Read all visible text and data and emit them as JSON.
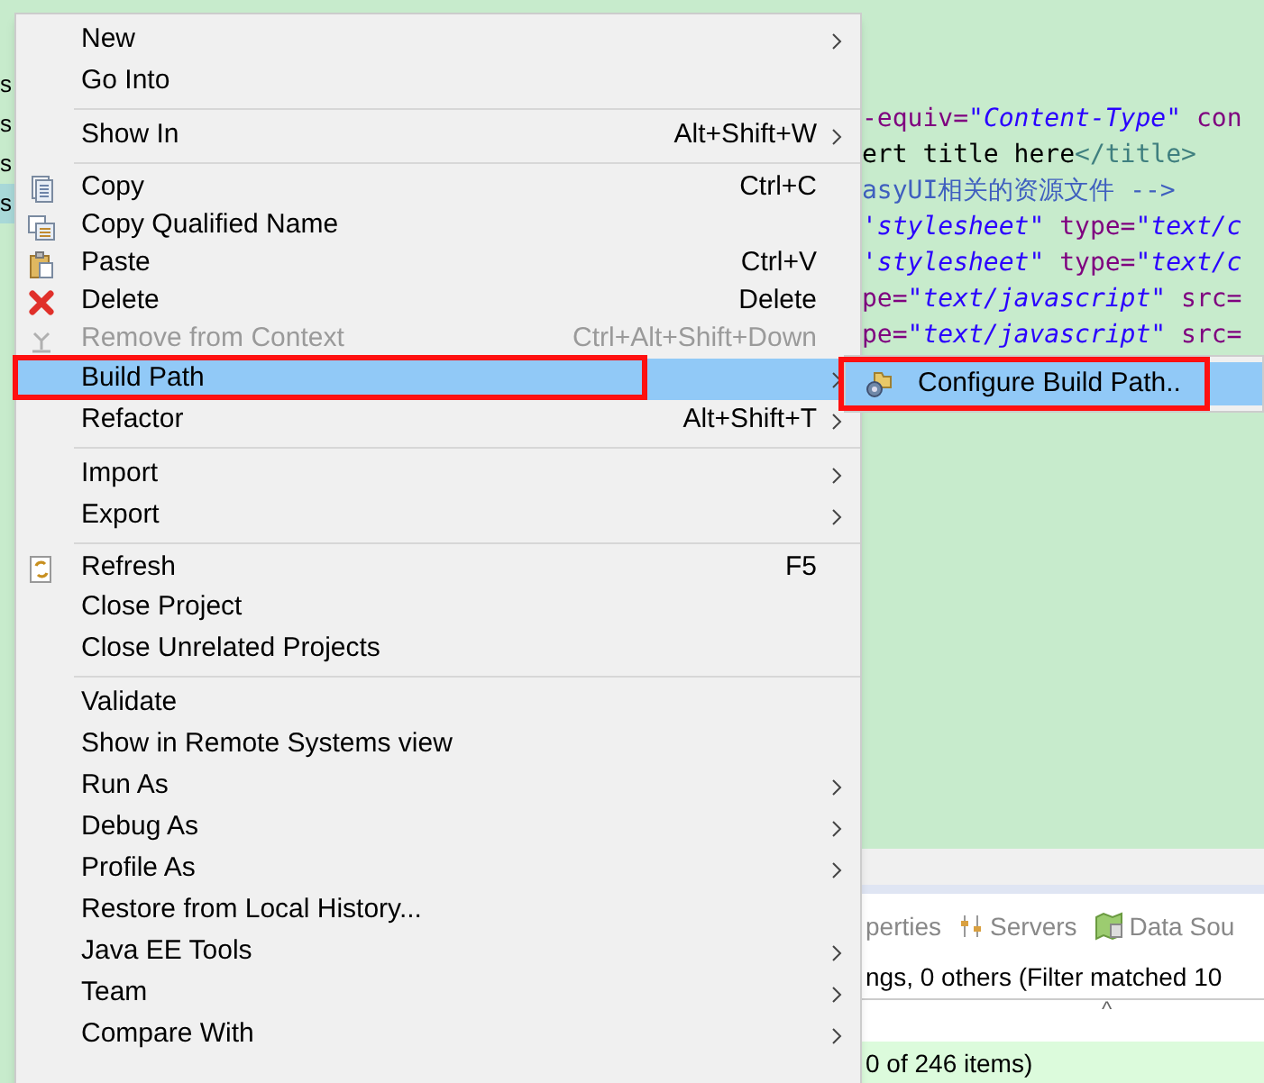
{
  "explorer": {
    "items": [
      {
        "label": "s",
        "selected": false
      },
      {
        "label": "s",
        "selected": false
      },
      {
        "label": "s",
        "selected": false
      },
      {
        "label": "s",
        "selected": true
      }
    ]
  },
  "editor": {
    "lines": [
      {
        "segments": [
          {
            "kind": "attr",
            "text": "-equiv="
          },
          {
            "kind": "string",
            "text": "\"Content-Type\""
          },
          {
            "kind": "attr",
            "text": " con"
          }
        ]
      },
      {
        "segments": [
          {
            "kind": "plain",
            "text": "ert title here"
          },
          {
            "kind": "tag",
            "text": "</title>"
          }
        ]
      },
      {
        "segments": [
          {
            "kind": "comment",
            "text": "asyUI相关的资源文件 -->"
          }
        ]
      },
      {
        "segments": [
          {
            "kind": "string",
            "text": "'stylesheet\""
          },
          {
            "kind": "attr",
            "text": " type="
          },
          {
            "kind": "string",
            "text": "\"text/c"
          }
        ]
      },
      {
        "segments": [
          {
            "kind": "string",
            "text": "'stylesheet\""
          },
          {
            "kind": "attr",
            "text": " type="
          },
          {
            "kind": "string",
            "text": "\"text/c"
          }
        ]
      },
      {
        "segments": [
          {
            "kind": "attr",
            "text": "pe="
          },
          {
            "kind": "string",
            "text": "\"text/javascript\""
          },
          {
            "kind": "attr",
            "text": " src="
          }
        ]
      },
      {
        "segments": [
          {
            "kind": "attr",
            "text": "pe="
          },
          {
            "kind": "string",
            "text": "\"text/javascript\""
          },
          {
            "kind": "attr",
            "text": " src="
          }
        ]
      }
    ]
  },
  "bottom_panel": {
    "tabs": [
      {
        "label": "perties",
        "kind": "none"
      },
      {
        "label": "Servers",
        "kind": "servers"
      },
      {
        "label": "Data Sou",
        "kind": "data"
      }
    ],
    "summary": "ngs, 0 others (Filter matched 10",
    "sort_caret": "^",
    "footer": "0 of 246 items)"
  },
  "context_menu": {
    "sections": [
      [
        {
          "label": "New",
          "submenu": true,
          "disabled": false,
          "selected": false
        },
        {
          "label": "Go Into",
          "submenu": false,
          "disabled": false,
          "selected": false
        }
      ],
      [
        {
          "label": "Show In",
          "shortcut": "Alt+Shift+W",
          "submenu": true,
          "disabled": false,
          "selected": false
        }
      ],
      [
        {
          "label": "Copy",
          "shortcut": "Ctrl+C",
          "kind": "copy",
          "submenu": false,
          "disabled": false,
          "selected": false
        },
        {
          "label": "Copy Qualified Name",
          "kind": "copy-qualified",
          "submenu": false,
          "disabled": false,
          "selected": false
        },
        {
          "label": "Paste",
          "shortcut": "Ctrl+V",
          "kind": "paste",
          "submenu": false,
          "disabled": false,
          "selected": false
        },
        {
          "label": "Delete",
          "shortcut": "Delete",
          "kind": "delete",
          "submenu": false,
          "disabled": false,
          "selected": false
        },
        {
          "label": "Remove from Context",
          "shortcut": "Ctrl+Alt+Shift+Down",
          "kind": "remove",
          "submenu": false,
          "disabled": true,
          "selected": false
        },
        {
          "label": "Build Path",
          "submenu": true,
          "disabled": false,
          "selected": true,
          "highlighted": true
        },
        {
          "label": "Refactor",
          "shortcut": "Alt+Shift+T",
          "submenu": true,
          "disabled": false,
          "selected": false
        }
      ],
      [
        {
          "label": "Import",
          "submenu": true,
          "disabled": false,
          "selected": false
        },
        {
          "label": "Export",
          "submenu": true,
          "disabled": false,
          "selected": false
        }
      ],
      [
        {
          "label": "Refresh",
          "shortcut": "F5",
          "kind": "refresh",
          "submenu": false,
          "disabled": false,
          "selected": false
        },
        {
          "label": "Close Project",
          "submenu": false,
          "disabled": false,
          "selected": false
        },
        {
          "label": "Close Unrelated Projects",
          "submenu": false,
          "disabled": false,
          "selected": false
        }
      ],
      [
        {
          "label": "Validate",
          "submenu": false,
          "disabled": false,
          "selected": false
        },
        {
          "label": "Show in Remote Systems view",
          "submenu": false,
          "disabled": false,
          "selected": false
        },
        {
          "label": "Run As",
          "submenu": true,
          "disabled": false,
          "selected": false
        },
        {
          "label": "Debug As",
          "submenu": true,
          "disabled": false,
          "selected": false
        },
        {
          "label": "Profile As",
          "submenu": true,
          "disabled": false,
          "selected": false
        },
        {
          "label": "Restore from Local History...",
          "submenu": false,
          "disabled": false,
          "selected": false
        },
        {
          "label": "Java EE Tools",
          "submenu": true,
          "disabled": false,
          "selected": false
        },
        {
          "label": "Team",
          "submenu": true,
          "disabled": false,
          "selected": false
        },
        {
          "label": "Compare With",
          "submenu": true,
          "disabled": false,
          "selected": false
        }
      ]
    ]
  },
  "submenu": {
    "items": [
      {
        "label": "Configure Build Path..",
        "kind": "configure",
        "selected": true,
        "highlighted": true
      }
    ]
  }
}
